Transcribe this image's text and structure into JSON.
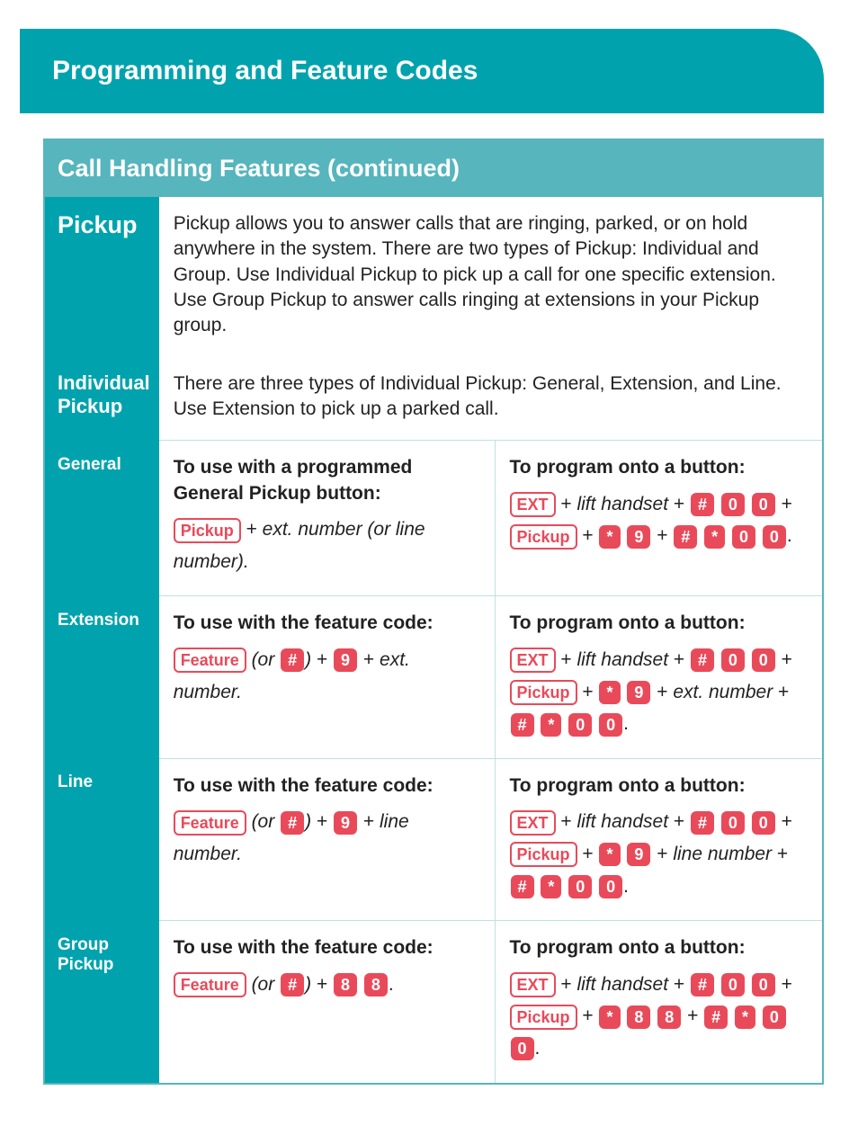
{
  "title": "Programming and Feature Codes",
  "section": "Call Handling Features (continued)",
  "labels": {
    "pickup": "Pickup",
    "individual": "Individual Pickup",
    "general": "General",
    "extension": "Extension",
    "line": "Line",
    "group": "Group Pickup"
  },
  "text": {
    "pickup_desc": "Pickup allows you to answer calls that are ringing, parked, or on hold anywhere in the system. There are two types of Pickup: Individual and Group. Use Individual Pickup to pick up a call for one specific extension. Use Group Pickup to answer calls ringing at extensions in your Pickup group.",
    "individual_desc": "There are three types of Individual Pickup: General, Extension, and Line. Use Extension to pick up a parked call.",
    "use_programmed": "To use with a programmed General Pickup button:",
    "use_feature": "To use with the feature code:",
    "program_btn": "To program onto a button:",
    "ext_or_line": "ext. number (or line number).",
    "ext_number": "ext. number.",
    "line_number": "line number.",
    "ext_number_plus": "ext. number",
    "line_number_plus": "line number",
    "lift_handset": "lift handset",
    "or": "(or",
    "plus": "+"
  },
  "keys": {
    "pickup": "Pickup",
    "feature": "Feature",
    "ext": "EXT",
    "hash": "#",
    "star": "*",
    "zero": "0",
    "nine": "9",
    "eight": "8"
  }
}
